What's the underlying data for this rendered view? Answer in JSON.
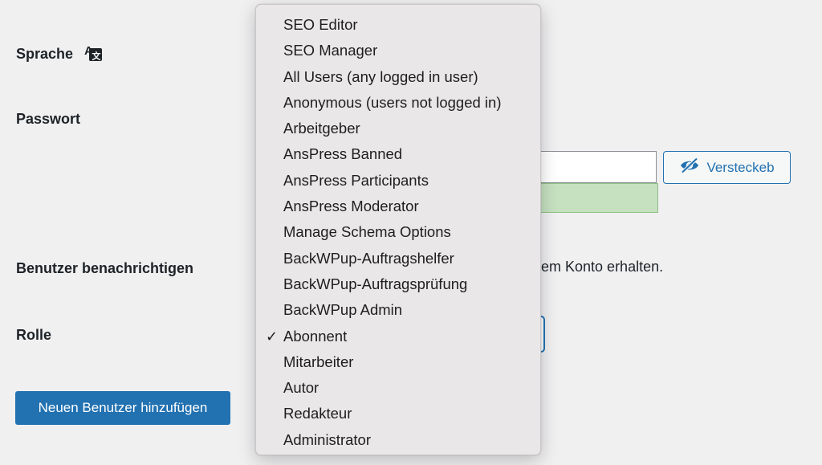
{
  "form": {
    "language_label": "Sprache",
    "password_label": "Passwort",
    "hide_password_label": "Versteckeb",
    "notify_label": "Benutzer benachrichtigen",
    "notify_text": "inem Konto erhalten.",
    "role_label": "Rolle",
    "add_user_label": "Neuen Benutzer hinzufügen"
  },
  "role_dropdown": {
    "selected": "Abonnent",
    "check_mark": "✓",
    "options": [
      "SEO Editor",
      "SEO Manager",
      "All Users (any logged in user)",
      "Anonymous (users not logged in)",
      "Arbeitgeber",
      "AnsPress Banned",
      "AnsPress Participants",
      "AnsPress Moderator",
      "Manage Schema Options",
      "BackWPup-Auftragshelfer",
      "BackWPup-Auftragsprüfung",
      "BackWPup Admin",
      "Abonnent",
      "Mitarbeiter",
      "Autor",
      "Redakteur",
      "Administrator"
    ]
  },
  "icons": {
    "language": "translation-icon",
    "hide": "eye-slash-icon"
  },
  "colors": {
    "accent": "#2271b1",
    "background": "#f0f0f1",
    "strength_good": "#c5e1c0",
    "dropdown_bg": "#e9e7e8"
  }
}
